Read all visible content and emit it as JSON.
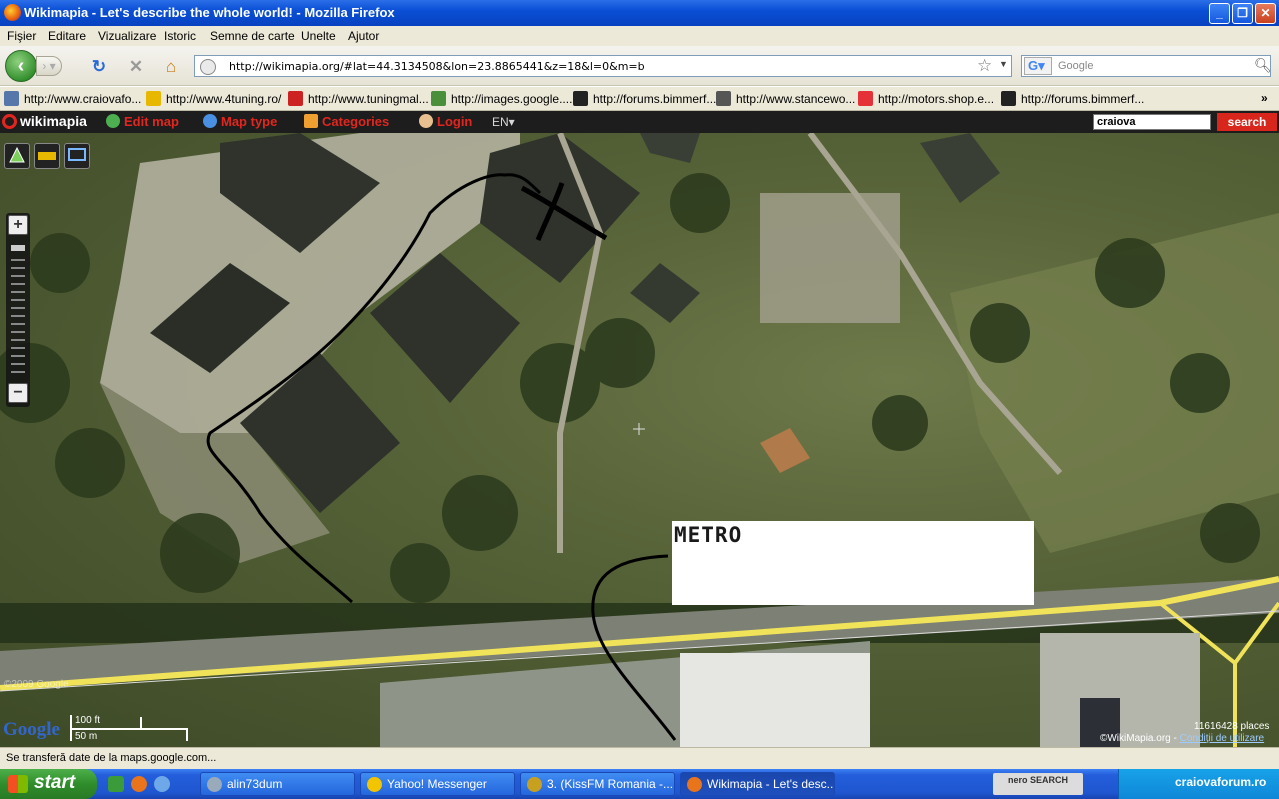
{
  "window": {
    "title": "Wikimapia - Let's describe the whole world! - Mozilla Firefox",
    "minimize": "_",
    "maximize": "❐",
    "close": "✕"
  },
  "menu": [
    "Fişier",
    "Editare",
    "Vizualizare",
    "Istoric",
    "Semne de carte",
    "Unelte",
    "Ajutor"
  ],
  "nav": {
    "url": "http://wikimapia.org/#lat=44.3134508&lon=23.8865441&z=18&l=0&m=b",
    "search_placeholder": "Google",
    "search_engine_letter": "G"
  },
  "bookmarks": [
    {
      "label": "http://www.craiovafo...",
      "icon": "globe-icon",
      "color": "#5577aa"
    },
    {
      "label": "http://www.4tuning.ro/",
      "icon": "car-icon",
      "color": "#e8b800"
    },
    {
      "label": "http://www.tuningmal...",
      "icon": "t-logo-icon",
      "color": "#cc2222"
    },
    {
      "label": "http://images.google....",
      "icon": "google-images-icon",
      "color": "#4a8f3a"
    },
    {
      "label": "http://forums.bimmerf...",
      "icon": "bmw-icon",
      "color": "#222222"
    },
    {
      "label": "http://www.stancewo...",
      "icon": "sw-icon",
      "color": "#555555"
    },
    {
      "label": "http://motors.shop.e...",
      "icon": "ebay-icon",
      "color": "#e53238"
    },
    {
      "label": "http://forums.bimmerf...",
      "icon": "bmw-icon",
      "color": "#222222"
    }
  ],
  "wikimapia": {
    "logo": "wikimapia",
    "edit_map": "Edit map",
    "map_type": "Map type",
    "categories": "Categories",
    "login": "Login",
    "lang": "EN▾",
    "search_value": "craiova",
    "search_button": "search"
  },
  "map": {
    "annotation_label": "METRO",
    "scale_ft": "100 ft",
    "scale_m": "50 m",
    "google_logo": "Google",
    "imagery_watermark": "©2009 Google",
    "places_count": "11616428 places",
    "copyright": "©WikiMapia.org -",
    "conditions_link": "Condiţii de utilizare"
  },
  "status": "Se transferă date de la maps.google.com...",
  "taskbar": {
    "start": "start",
    "tasks": [
      {
        "label": "alin73dum",
        "active": false
      },
      {
        "label": "Yahoo! Messenger",
        "active": false
      },
      {
        "label": "3. (KissFM Romania -...",
        "active": false
      },
      {
        "label": "Wikimapia - Let's desc...",
        "active": true
      }
    ],
    "nero": "nero SEARCH",
    "tray_site": "craiovaforum.ro"
  }
}
